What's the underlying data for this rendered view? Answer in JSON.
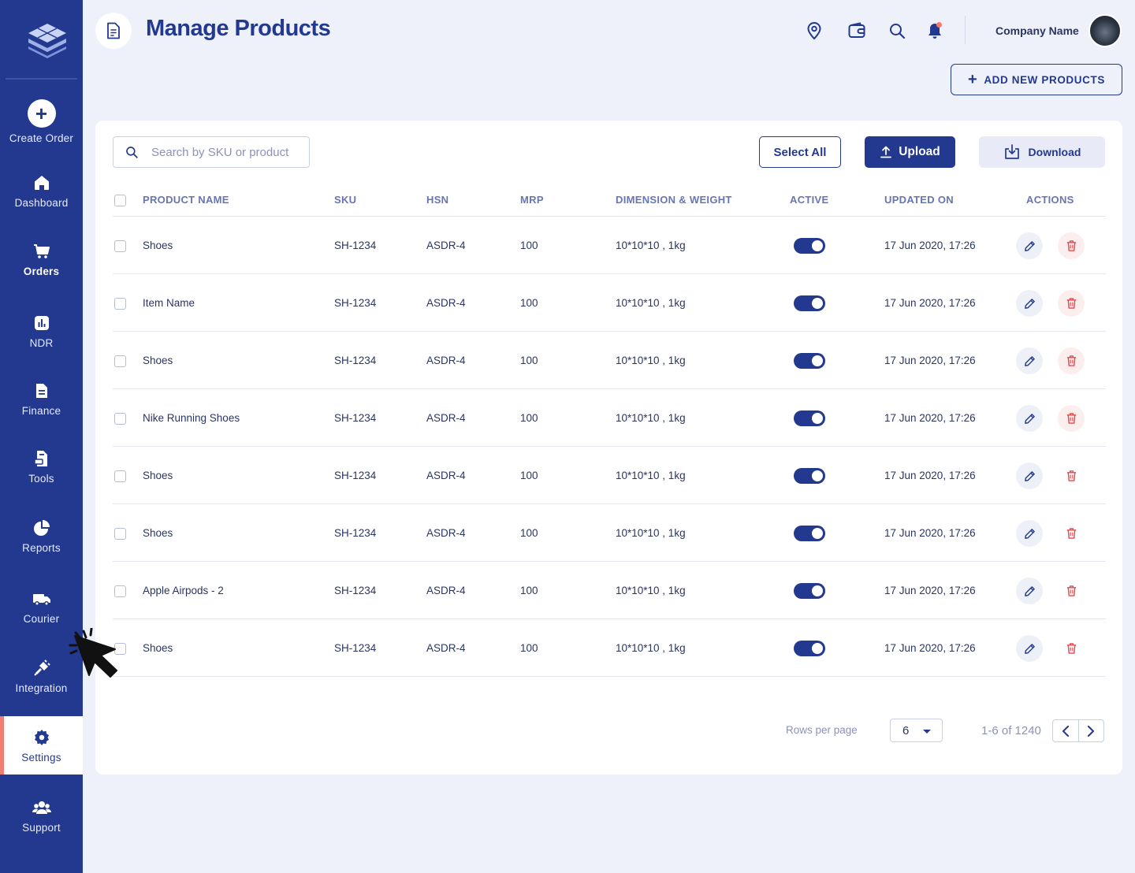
{
  "sidebar": {
    "items": [
      {
        "label": "Create Order",
        "icon": "plus-circle-icon"
      },
      {
        "label": "Dashboard",
        "icon": "home-icon"
      },
      {
        "label": "Orders",
        "icon": "cart-icon"
      },
      {
        "label": "NDR",
        "icon": "bar-chart-icon"
      },
      {
        "label": "Finance",
        "icon": "document-icon"
      },
      {
        "label": "Tools",
        "icon": "tools-icon"
      },
      {
        "label": "Reports",
        "icon": "pie-chart-icon"
      },
      {
        "label": "Courier",
        "icon": "truck-icon"
      },
      {
        "label": "Integration",
        "icon": "plug-icon"
      },
      {
        "label": "Settings",
        "icon": "gear-icon"
      },
      {
        "label": "Support",
        "icon": "people-icon"
      }
    ],
    "active": "Settings"
  },
  "header": {
    "title": "Manage Products",
    "company": "Company Name"
  },
  "toolbar": {
    "add_label": "ADD NEW PRODUCTS",
    "search_placeholder": "Search by SKU or product",
    "select_all_label": "Select All",
    "upload_label": "Upload",
    "download_label": "Download"
  },
  "table": {
    "columns": [
      "PRODUCT NAME",
      "SKU",
      "HSN",
      "MRP",
      "DIMENSION & WEIGHT",
      "ACTIVE",
      "UPDATED ON",
      "ACTIONS"
    ],
    "rows": [
      {
        "name": "Shoes",
        "sku": "SH-1234",
        "hsn": "ASDR-4",
        "mrp": "100",
        "dim": "10*10*10 , 1kg",
        "active": true,
        "updated": "17 Jun 2020, 17:26"
      },
      {
        "name": "Item Name",
        "sku": "SH-1234",
        "hsn": "ASDR-4",
        "mrp": "100",
        "dim": "10*10*10 , 1kg",
        "active": true,
        "updated": "17 Jun 2020, 17:26"
      },
      {
        "name": "Shoes",
        "sku": "SH-1234",
        "hsn": "ASDR-4",
        "mrp": "100",
        "dim": "10*10*10 , 1kg",
        "active": true,
        "updated": "17 Jun 2020, 17:26"
      },
      {
        "name": "Nike Running Shoes",
        "sku": "SH-1234",
        "hsn": "ASDR-4",
        "mrp": "100",
        "dim": "10*10*10 , 1kg",
        "active": true,
        "updated": "17 Jun 2020, 17:26"
      },
      {
        "name": "Shoes",
        "sku": "SH-1234",
        "hsn": "ASDR-4",
        "mrp": "100",
        "dim": "10*10*10 , 1kg",
        "active": true,
        "updated": "17 Jun 2020, 17:26"
      },
      {
        "name": "Shoes",
        "sku": "SH-1234",
        "hsn": "ASDR-4",
        "mrp": "100",
        "dim": "10*10*10 , 1kg",
        "active": true,
        "updated": "17 Jun 2020, 17:26"
      },
      {
        "name": "Apple Airpods - 2",
        "sku": "SH-1234",
        "hsn": "ASDR-4",
        "mrp": "100",
        "dim": "10*10*10 , 1kg",
        "active": true,
        "updated": "17 Jun 2020, 17:26"
      },
      {
        "name": "Shoes",
        "sku": "SH-1234",
        "hsn": "ASDR-4",
        "mrp": "100",
        "dim": "10*10*10 , 1kg",
        "active": true,
        "updated": "17 Jun 2020, 17:26"
      }
    ]
  },
  "pagination": {
    "rows_per_page_label": "Rows per page",
    "rows_per_page": "6",
    "range": "1-6 of 1240"
  },
  "colors": {
    "primary": "#23398f",
    "accent": "#f07c72",
    "background": "#eef0fa"
  }
}
